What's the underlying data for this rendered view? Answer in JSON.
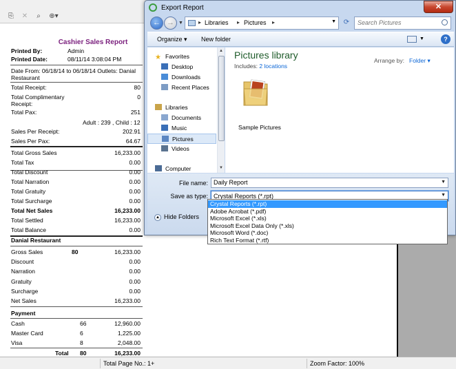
{
  "viewer": {
    "status": {
      "total_pages": "Total Page No.: 1+",
      "zoom": "Zoom Factor: 100%"
    }
  },
  "report": {
    "title": "Cashier Sales Report",
    "printed_by_label": "Printed By:",
    "printed_by": "Admin",
    "printed_date_label": "Printed Date:",
    "printed_date": "08/11/14 3:08:04 PM",
    "date_range_line1": "Date From: 06/18/14 to 06/18/14 Outlets: Danial",
    "date_range_line2": "Restaurant",
    "summary": [
      {
        "label": "Total Receipt:",
        "value": "80"
      },
      {
        "label": "Total Complimentary",
        "value": "0"
      },
      {
        "label": "Receipt:",
        "value": ""
      },
      {
        "label": "Total Pax:",
        "value": "251"
      }
    ],
    "pax_detail": "Adult : 239 , Child : 12",
    "per_stats": [
      {
        "label": "Sales Per Receipt:",
        "value": "202.91"
      },
      {
        "label": "Sales Per Pax:",
        "value": "64.67"
      }
    ],
    "totals": [
      {
        "label": "Total Gross Sales",
        "value": "16,233.00",
        "bold": false
      },
      {
        "label": "Total Tax",
        "value": "0.00",
        "bold": false
      },
      {
        "label": "Total Discount",
        "value": "0.00",
        "bold": false
      },
      {
        "label": "Total Narration",
        "value": "0.00",
        "bold": false
      },
      {
        "label": "Total Gratuity",
        "value": "0.00",
        "bold": false
      },
      {
        "label": "Total Surcharge",
        "value": "0.00",
        "bold": false
      },
      {
        "label": "Total Net Sales",
        "value": "16,233.00",
        "bold": true
      },
      {
        "label": "Total Settled",
        "value": "16,233.00",
        "bold": false
      },
      {
        "label": "Total Balance",
        "value": "0.00",
        "bold": false
      }
    ],
    "outlet_heading": "Danial Restaurant",
    "outlet_rows": [
      {
        "label": "Gross Sales",
        "count": "80",
        "value": "16,233.00"
      },
      {
        "label": "Discount",
        "count": "",
        "value": "0.00"
      },
      {
        "label": "Narration",
        "count": "",
        "value": "0.00"
      },
      {
        "label": "Gratuity",
        "count": "",
        "value": "0.00"
      },
      {
        "label": "Surcharge",
        "count": "",
        "value": "0.00"
      },
      {
        "label": "Net Sales",
        "count": "",
        "value": "16,233.00"
      }
    ],
    "payment_heading": "Payment",
    "payment_rows": [
      {
        "label": "Cash",
        "count": "66",
        "value": "12,960.00"
      },
      {
        "label": "Master Card",
        "count": "6",
        "value": "1,225.00"
      },
      {
        "label": "Visa",
        "count": "8",
        "value": "2,048.00"
      }
    ],
    "payment_total": {
      "label": "Total",
      "count": "80",
      "value": "16,233.00"
    }
  },
  "dialog": {
    "title": "Export Report",
    "close": "✕",
    "breadcrumb": [
      "Libraries",
      "Pictures"
    ],
    "search_placeholder": "Search Pictures",
    "toolbar": {
      "organize": "Organize ▾",
      "new_folder": "New folder"
    },
    "nav": [
      {
        "label": "Favorites",
        "icon": "star-icon",
        "indent": 0
      },
      {
        "label": "Desktop",
        "icon": "desktop-icon",
        "indent": 1
      },
      {
        "label": "Downloads",
        "icon": "downloads-icon",
        "indent": 1
      },
      {
        "label": "Recent Places",
        "icon": "recent-places-icon",
        "indent": 1
      },
      {
        "label": "Libraries",
        "icon": "libraries-icon",
        "indent": 0
      },
      {
        "label": "Documents",
        "icon": "documents-icon",
        "indent": 1
      },
      {
        "label": "Music",
        "icon": "music-icon",
        "indent": 1
      },
      {
        "label": "Pictures",
        "icon": "pictures-icon",
        "indent": 1
      },
      {
        "label": "Videos",
        "icon": "videos-icon",
        "indent": 1
      },
      {
        "label": "Computer",
        "icon": "computer-icon",
        "indent": 0
      }
    ],
    "library_title": "Pictures library",
    "includes_label": "Includes:",
    "includes_link": "2 locations",
    "arrange_label": "Arrange by:",
    "arrange_value": "Folder",
    "folder_item": "Sample Pictures",
    "file_name_label": "File name:",
    "file_name": "Daily Report",
    "save_type_label": "Save as type:",
    "save_type": "Crystal Reports (*.rpt)",
    "hide_folders": "Hide Folders",
    "type_options": [
      "Crystal Reports (*.rpt)",
      "Adobe Acrobat (*.pdf)",
      "Microsoft Excel (*.xls)",
      "Microsoft Excel Data Only (*.xls)",
      "Microsoft Word (*.doc)",
      "Rich Text Format (*.rtf)"
    ],
    "selected_type_index": 0
  }
}
